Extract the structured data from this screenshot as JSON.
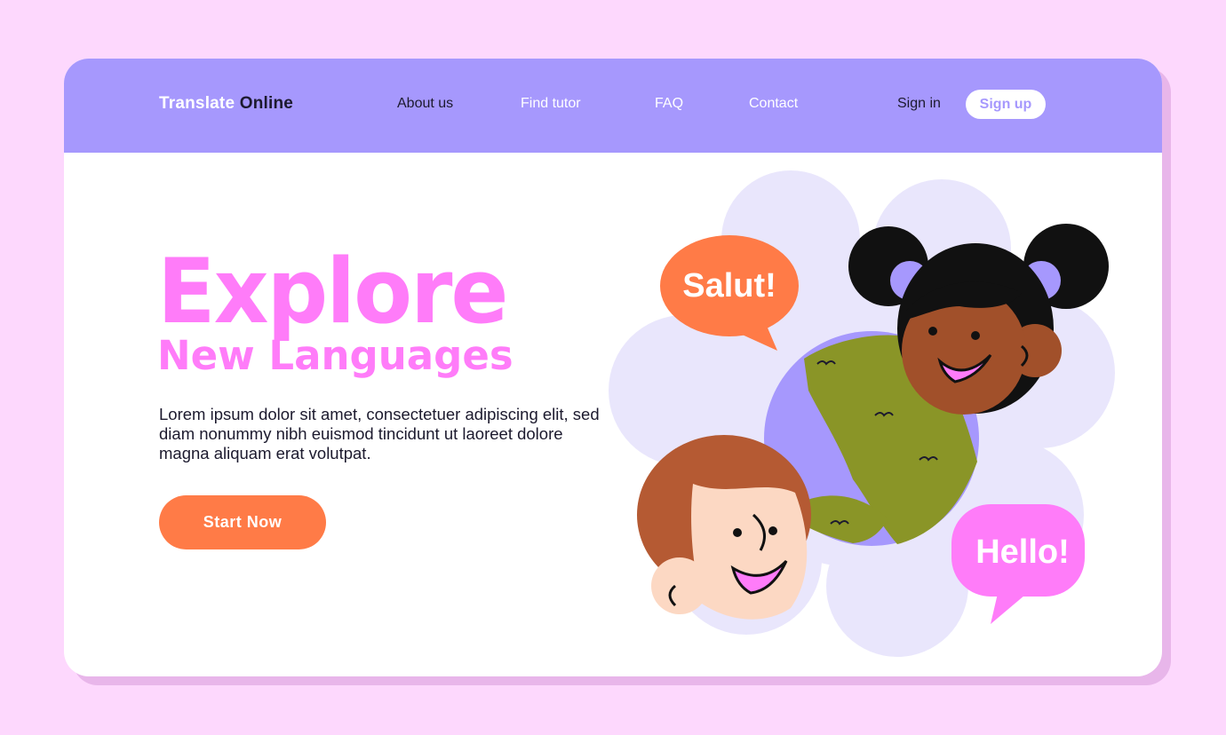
{
  "header": {
    "brand_part1": "Translate",
    "brand_part2": "Online",
    "nav": {
      "about": "About us",
      "find_tutor": "Find tutor",
      "faq": "FAQ",
      "contact": "Contact"
    },
    "sign_in": "Sign in",
    "sign_up": "Sign up"
  },
  "hero": {
    "title_line1": "Explore",
    "title_line2": "New Languages",
    "body": "Lorem ipsum dolor sit amet, consectetuer adipiscing elit, sed diam nonummy nibh euismod tincidunt ut laoreet dolore magna aliquam erat volutpat.",
    "cta": "Start Now"
  },
  "illustration": {
    "bubble_top": "Salut!",
    "bubble_bottom": "Hello!"
  },
  "colors": {
    "page_bg": "#fdd8fd",
    "navbar": "#a698fd",
    "title_pink": "#ff7cf9",
    "cta_orange": "#ff7b47",
    "globe_blue": "#a698fd",
    "globe_green": "#8a9527"
  }
}
